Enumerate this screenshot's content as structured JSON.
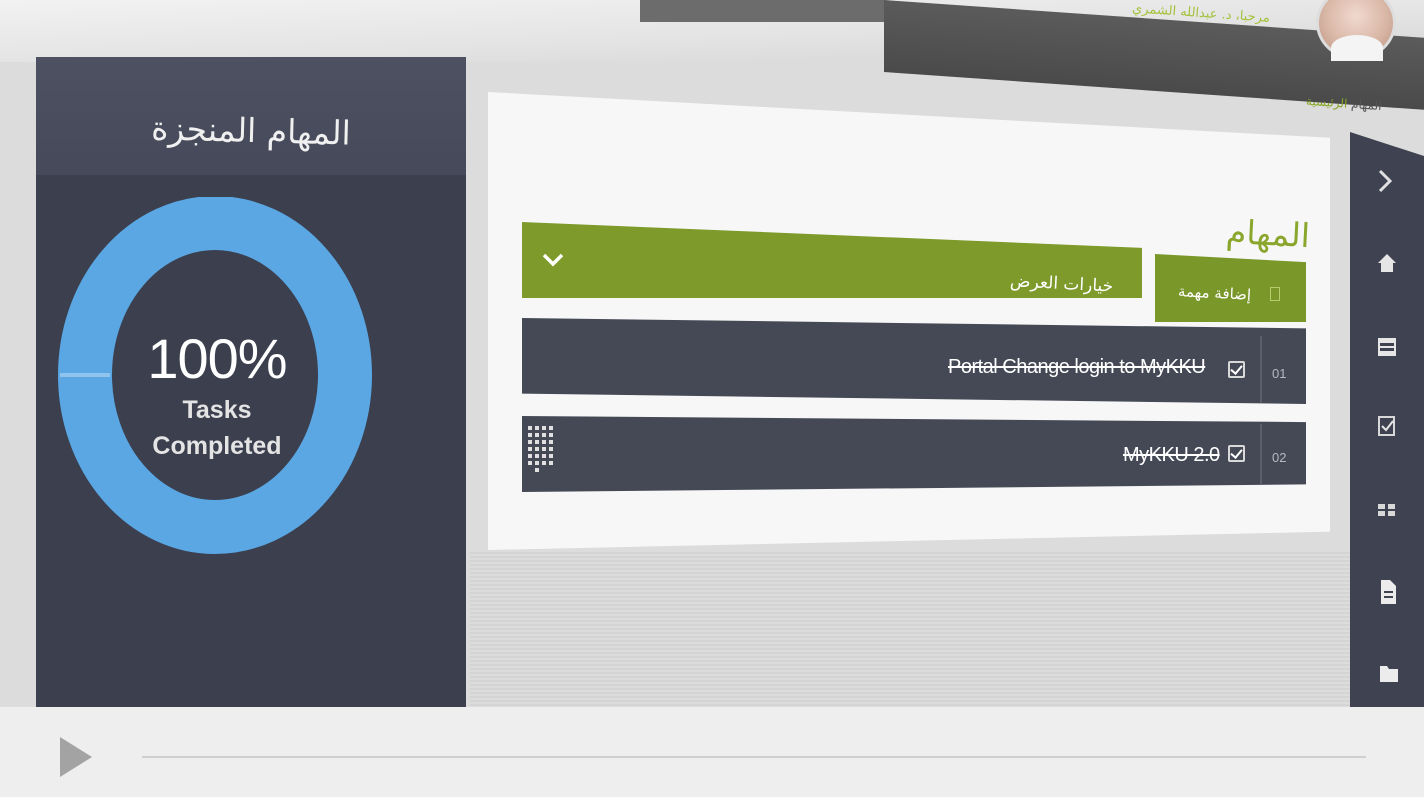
{
  "header": {
    "welcome_text": "مرحبا، د. عبدالله الشمري",
    "breadcrumb": {
      "home": "الرئيسية",
      "current": "المهام"
    }
  },
  "stats_panel": {
    "title": "المهام المنجزة",
    "percent_label": "100%",
    "caption_line1": "Tasks",
    "caption_line2": "Completed",
    "completed_fraction": 1.0,
    "ring_color": "#5aa7e3"
  },
  "tasks_page": {
    "heading": "المهام",
    "add_button_label": "إضافة مهمة",
    "view_options_label": "خيارات العرض",
    "tasks": [
      {
        "number": "01",
        "text": "Portal Change login to MyKKU",
        "done": true
      },
      {
        "number": "02",
        "text": "MyKKU 2.0",
        "done": true
      }
    ]
  },
  "sidebar_icons": [
    "chevron-right-icon",
    "home-icon",
    "calendar-icon",
    "checklist-icon",
    "grid-icon",
    "document-icon",
    "folder-icon"
  ],
  "player": {
    "progress_fraction": 0.0
  },
  "colors": {
    "accent_green": "#7d9a2a",
    "panel_dark": "#3b3f4e",
    "ring_blue": "#5aa7e3"
  }
}
